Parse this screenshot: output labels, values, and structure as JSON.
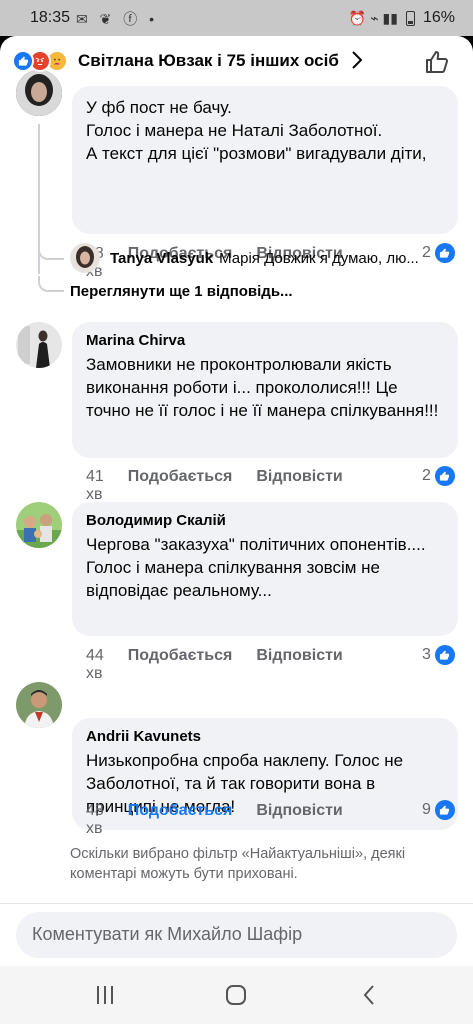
{
  "status_bar": {
    "time": "18:35",
    "notification_icons": "✉ ❦ ⓕ •",
    "right_icons": "⏰ ⌁ ▮▮",
    "battery": "16%"
  },
  "header": {
    "reactors": "Світлана Ювзак і 75 інших осіб",
    "reaction_icons": [
      "like",
      "angry",
      "care"
    ]
  },
  "comments": [
    {
      "name": "",
      "text": "У фб пост не бачу.\nГолос і манера не Наталі Заболотної.\nА текст для цієї \"розмови\" вигадували діти,",
      "time": "38 хв",
      "like_label": "Подобається",
      "reply_label": "Відповісти",
      "reactions": "2",
      "liked": false
    },
    {
      "name": "Marina  Chirva",
      "text": "Замовники не проконтролювали якість виконання роботи і... прокололися!!! Це точно не її голос і не її манера спілкування!!!",
      "time": "41 хв",
      "like_label": "Подобається",
      "reply_label": "Відповісти",
      "reactions": "2",
      "liked": false
    },
    {
      "name": "Володимир Скалій",
      "text": "Чергова \"заказуха\" політичних опонентів.... Голос і манера спілкування зовсім не відповідає реальному...",
      "time": "44 хв",
      "like_label": "Подобається",
      "reply_label": "Відповісти",
      "reactions": "3",
      "liked": false
    },
    {
      "name": "Andrii Kavunets",
      "text": "Низькопробна спроба наклепу. Голос не Заболотної, та й так говорити вона в принципі не могла!",
      "time": "48 хв",
      "like_label": "Подобається",
      "reply_label": "Відповісти",
      "reactions": "9",
      "liked": true
    }
  ],
  "reply_preview": {
    "name": "Tanya Vlasyuk",
    "text": "Марія Довжик  я думаю, лю..."
  },
  "view_more_replies": "Переглянути ще 1 відповідь...",
  "filter_note": "Оскільки вибрано фільтр «Найактуальніші», деякі коментарі можуть бути приховані.",
  "composer": {
    "placeholder": "Коментувати як Михайло Шафір"
  },
  "colors": {
    "accent": "#1877f2",
    "bubble": "#f0f2f5",
    "secondary_text": "#65676b"
  }
}
